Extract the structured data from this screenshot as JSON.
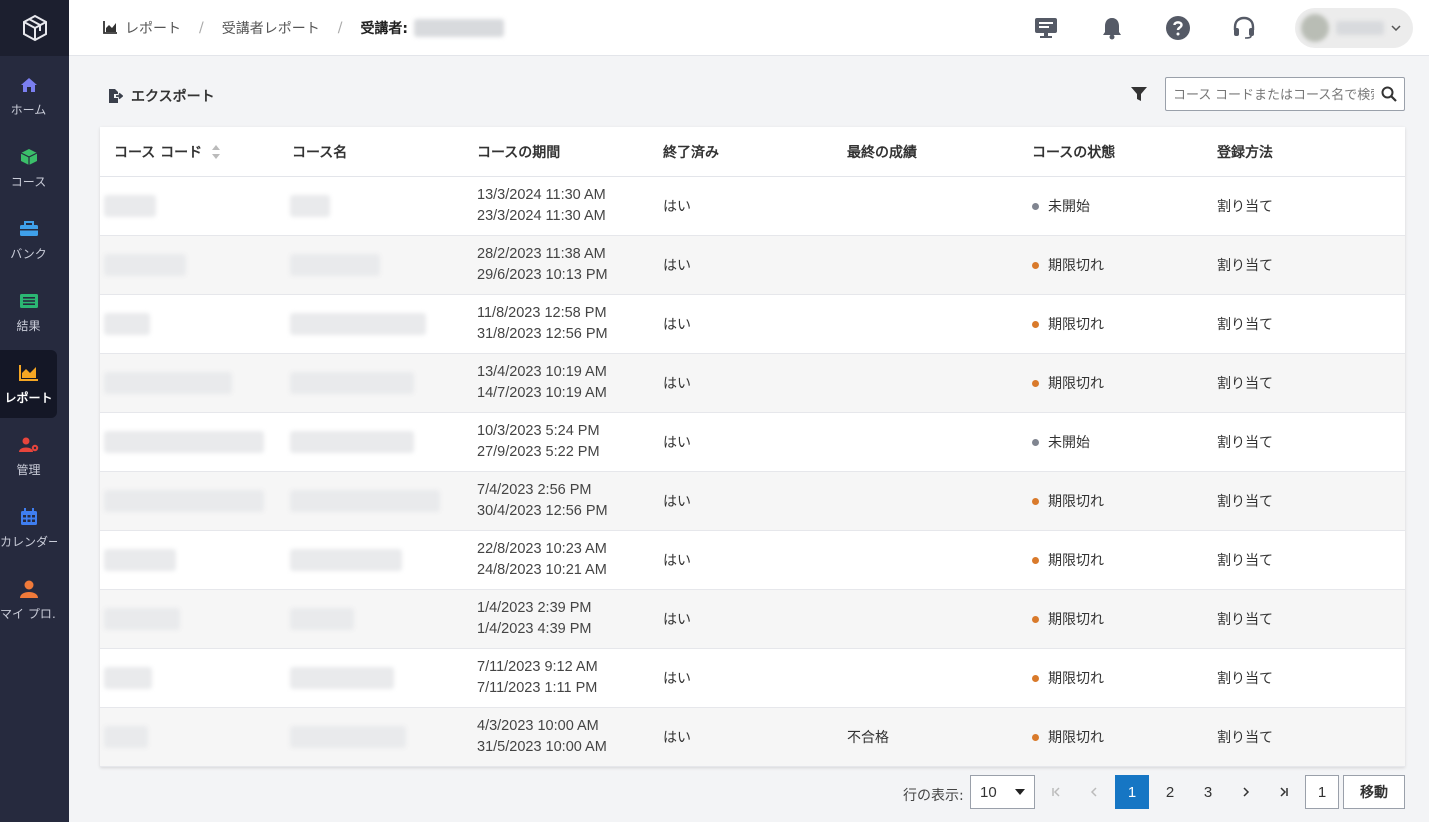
{
  "sidebar": {
    "items": [
      {
        "label": "ホーム",
        "icon": "home-icon",
        "color": "#7b7ff0"
      },
      {
        "label": "コース",
        "icon": "cube-icon",
        "color": "#3bbf6a"
      },
      {
        "label": "バンク",
        "icon": "toolbox-icon",
        "color": "#3fa0ea"
      },
      {
        "label": "結果",
        "icon": "table-icon",
        "color": "#2bb673"
      },
      {
        "label": "レポート",
        "icon": "area-chart-icon",
        "color": "#f5a623",
        "active": true
      },
      {
        "label": "管理",
        "icon": "user-cog-icon",
        "color": "#e8453c"
      },
      {
        "label": "カレンダー",
        "icon": "calendar-icon",
        "color": "#3f7ef0"
      },
      {
        "label": "マイ プロ…",
        "icon": "user-icon",
        "color": "#f07a3a"
      }
    ]
  },
  "breadcrumb": {
    "report": "レポート",
    "learner_report": "受講者レポート",
    "learner_label": "受講者:"
  },
  "toolbar": {
    "export_label": "エクスポート",
    "search_placeholder": "コース コードまたはコース名で検索"
  },
  "table": {
    "headers": {
      "code": "コース コード",
      "name": "コース名",
      "period": "コースの期間",
      "completed": "終了済み",
      "grade": "最終の成績",
      "status": "コースの状態",
      "enroll": "登録方法"
    },
    "rows": [
      {
        "start": "13/3/2024 11:30 AM",
        "end": "23/3/2024 11:30 AM",
        "completed": "はい",
        "grade": "",
        "status": "未開始",
        "status_color": "#808590",
        "enroll": "割り当て"
      },
      {
        "start": "28/2/2023 11:38 AM",
        "end": "29/6/2023 10:13 PM",
        "completed": "はい",
        "grade": "",
        "status": "期限切れ",
        "status_color": "#d97a2b",
        "enroll": "割り当て"
      },
      {
        "start": "11/8/2023 12:58 PM",
        "end": "31/8/2023 12:56 PM",
        "completed": "はい",
        "grade": "",
        "status": "期限切れ",
        "status_color": "#d97a2b",
        "enroll": "割り当て"
      },
      {
        "start": "13/4/2023 10:19 AM",
        "end": "14/7/2023 10:19 AM",
        "completed": "はい",
        "grade": "",
        "status": "期限切れ",
        "status_color": "#d97a2b",
        "enroll": "割り当て"
      },
      {
        "start": "10/3/2023 5:24 PM",
        "end": "27/9/2023 5:22 PM",
        "completed": "はい",
        "grade": "",
        "status": "未開始",
        "status_color": "#808590",
        "enroll": "割り当て"
      },
      {
        "start": "7/4/2023 2:56 PM",
        "end": "30/4/2023 12:56 PM",
        "completed": "はい",
        "grade": "",
        "status": "期限切れ",
        "status_color": "#d97a2b",
        "enroll": "割り当て"
      },
      {
        "start": "22/8/2023 10:23 AM",
        "end": "24/8/2023 10:21 AM",
        "completed": "はい",
        "grade": "",
        "status": "期限切れ",
        "status_color": "#d97a2b",
        "enroll": "割り当て"
      },
      {
        "start": "1/4/2023 2:39 PM",
        "end": "1/4/2023 4:39 PM",
        "completed": "はい",
        "grade": "",
        "status": "期限切れ",
        "status_color": "#d97a2b",
        "enroll": "割り当て"
      },
      {
        "start": "7/11/2023 9:12 AM",
        "end": "7/11/2023 1:11 PM",
        "completed": "はい",
        "grade": "",
        "status": "期限切れ",
        "status_color": "#d97a2b",
        "enroll": "割り当て"
      },
      {
        "start": "4/3/2023 10:00 AM",
        "end": "31/5/2023 10:00 AM",
        "completed": "はい",
        "grade": "不合格",
        "status": "期限切れ",
        "status_color": "#d97a2b",
        "enroll": "割り当て"
      }
    ]
  },
  "pagination": {
    "rows_label": "行の表示:",
    "rows_per_page": "10",
    "pages": [
      "1",
      "2",
      "3"
    ],
    "current_page": "1",
    "goto_value": "1",
    "goto_label": "移動"
  }
}
